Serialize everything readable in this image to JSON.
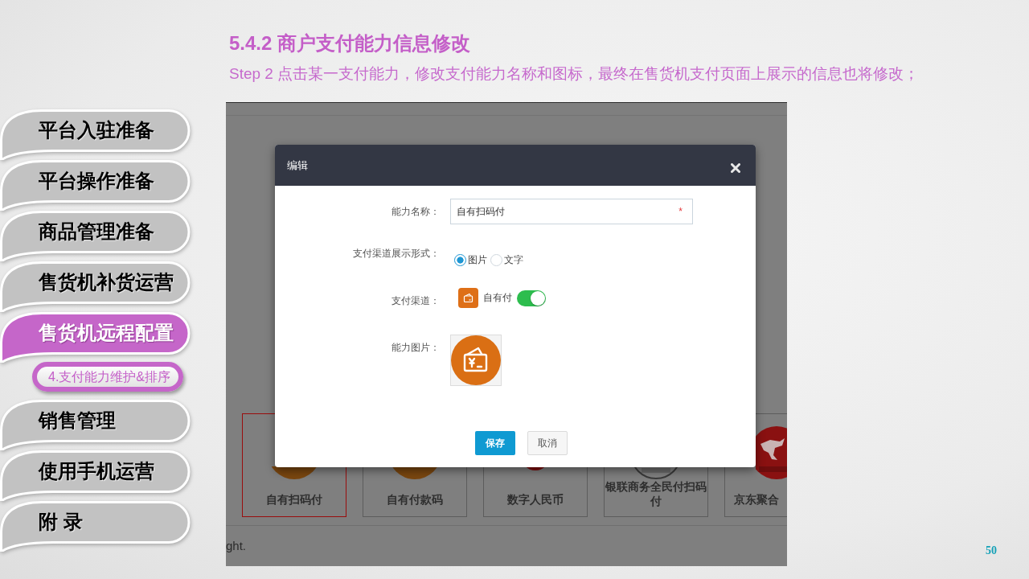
{
  "sidebar": {
    "items": [
      {
        "label": "平台入驻准备",
        "selected": false
      },
      {
        "label": "平台操作准备",
        "selected": false
      },
      {
        "label": "商品管理准备",
        "selected": false
      },
      {
        "label": "售货机补货运营",
        "selected": false
      },
      {
        "label": "售货机远程配置",
        "selected": true,
        "children": [
          {
            "label": "4.支付能力维护&排序",
            "selected": true
          }
        ]
      },
      {
        "label": "销售管理",
        "selected": false
      },
      {
        "label": "使用手机运营",
        "selected": false
      },
      {
        "label": "附 录",
        "selected": false
      }
    ]
  },
  "header": {
    "title": "5.4.2 商户支付能力信息修改",
    "subtitle": "Step 2 点击某一支付能力，修改支付能力名称和图标，最终在售货机支付页面上展示的信息也将修改；"
  },
  "screenshot": {
    "cards": [
      {
        "label": "自有扫码付",
        "kind": "wallet",
        "selected": true
      },
      {
        "label": "自有付款码",
        "kind": "wallet",
        "selected": false
      },
      {
        "label": "数字人民币",
        "kind": "coin",
        "selected": false
      },
      {
        "label": "银联商务全民付扫码付",
        "kind": "seal",
        "selected": false
      },
      {
        "label": "京东聚合",
        "kind": "bird",
        "selected": false
      }
    ],
    "footer": "ght.",
    "dialog": {
      "title": "编辑",
      "fields": [
        {
          "kind": "text",
          "label": "能力名称：",
          "value": "自有扫码付",
          "required_mark": "*"
        },
        {
          "kind": "radio",
          "label": "支付渠道展示形式：",
          "options": [
            {
              "label": "图片",
              "selected": true
            },
            {
              "label": "文字",
              "selected": false
            }
          ]
        },
        {
          "kind": "channel",
          "label": "支付渠道：",
          "channel": "自有付",
          "on": true
        },
        {
          "kind": "image",
          "label": "能力图片："
        }
      ],
      "buttons": [
        {
          "label": "保存",
          "kind": "primary"
        },
        {
          "label": "取消",
          "kind": "default"
        }
      ]
    }
  },
  "page_number": "50"
}
